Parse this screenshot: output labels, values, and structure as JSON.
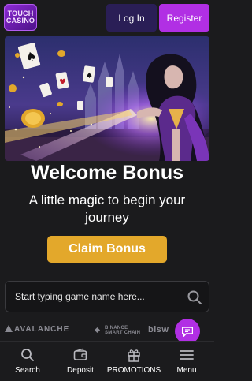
{
  "header": {
    "logo_line1": "TOUCH",
    "logo_line2": "CASINO",
    "login_label": "Log In",
    "register_label": "Register"
  },
  "promo": {
    "title": "Welcome Bonus",
    "subtitle": "A little magic to begin your journey",
    "cta_label": "Claim Bonus"
  },
  "search": {
    "placeholder": "Start typing game name here..."
  },
  "partners": [
    "AVALANCHE",
    "BINANCE",
    "SMART CHAIN",
    "bisw"
  ],
  "bottom_nav": {
    "items": [
      {
        "label": "Search",
        "icon": "search-icon"
      },
      {
        "label": "Deposit",
        "icon": "wallet-icon"
      },
      {
        "label": "PROMOTIONS",
        "icon": "gift-icon"
      },
      {
        "label": "Menu",
        "icon": "menu-icon"
      }
    ]
  },
  "colors": {
    "background": "#1b1b1d",
    "login_bg": "#2a1e56",
    "accent_purple": "#b12fe4",
    "claim_gold": "#e3a82b"
  }
}
